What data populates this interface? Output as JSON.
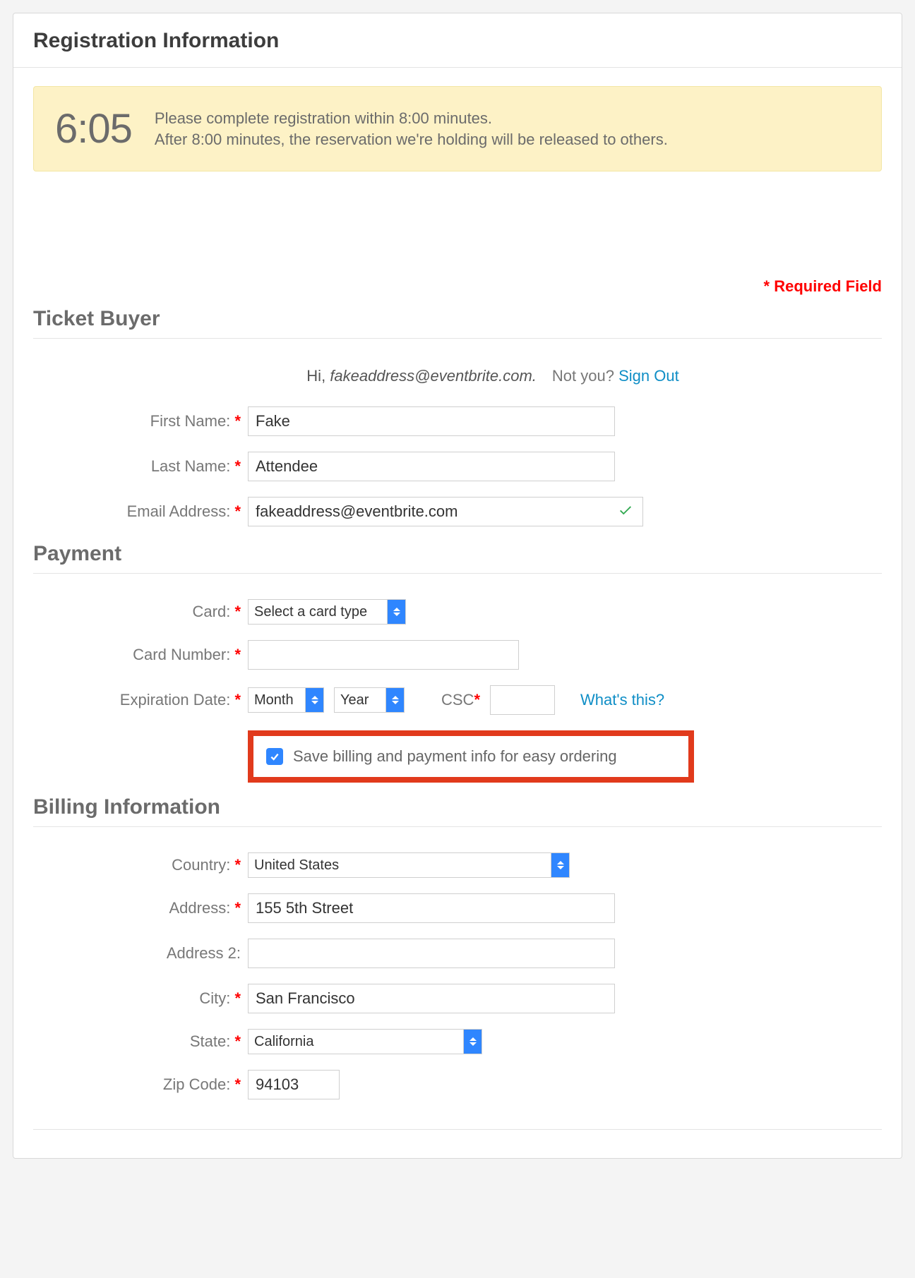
{
  "header": {
    "title": "Registration Information"
  },
  "timer": {
    "value": "6:05",
    "line1": "Please complete registration within 8:00 minutes.",
    "line2": "After 8:00 minutes, the reservation we're holding will be released to others."
  },
  "required_field_label": "* Required Field",
  "sections": {
    "ticket_buyer": "Ticket Buyer",
    "payment": "Payment",
    "billing": "Billing Information"
  },
  "greeting": {
    "hi": "Hi,",
    "email": "fakeaddress@eventbrite.com.",
    "not_you": "Not you?",
    "sign_out": "Sign Out"
  },
  "buyer": {
    "first_name_label": "First Name:",
    "first_name_value": "Fake",
    "last_name_label": "Last Name:",
    "last_name_value": "Attendee",
    "email_label": "Email Address:",
    "email_value": "fakeaddress@eventbrite.com"
  },
  "payment": {
    "card_label": "Card:",
    "card_select": "Select a card type",
    "card_number_label": "Card Number:",
    "card_number_value": "",
    "exp_label": "Expiration Date:",
    "month_select": "Month",
    "year_select": "Year",
    "csc_label": "CSC",
    "csc_value": "",
    "whats_this": "What's this?",
    "save_info_label": "Save billing and payment info for easy ordering"
  },
  "billing": {
    "country_label": "Country:",
    "country_value": "United States",
    "address_label": "Address:",
    "address_value": "155 5th Street",
    "address2_label": "Address 2:",
    "address2_value": "",
    "city_label": "City:",
    "city_value": "San Francisco",
    "state_label": "State:",
    "state_value": "California",
    "zip_label": "Zip Code:",
    "zip_value": "94103"
  },
  "required_marker": "*"
}
